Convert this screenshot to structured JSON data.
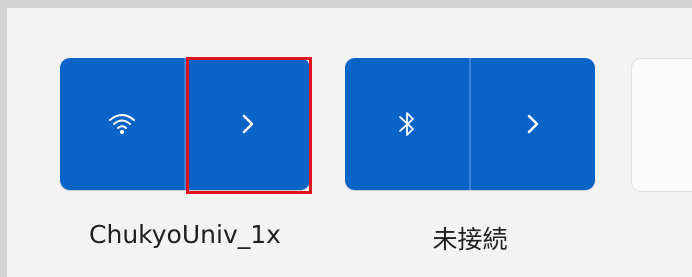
{
  "quick_settings": {
    "wifi": {
      "network_name": "ChukyoUniv_1x",
      "icon": "wifi-icon",
      "expand_icon": "chevron-right-icon"
    },
    "bluetooth": {
      "status": "未接続",
      "icon": "bluetooth-icon",
      "expand_icon": "chevron-right-icon"
    }
  },
  "colors": {
    "tile_active": "#0a63c6",
    "highlight": "#e3131e",
    "panel": "#f3f3f3"
  }
}
